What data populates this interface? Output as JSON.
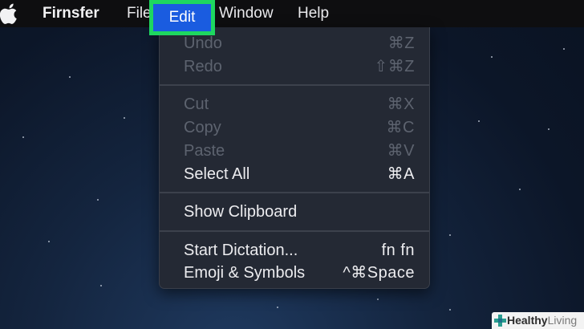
{
  "menubar": {
    "app_name": "Firnsfer",
    "items": [
      {
        "label": "File"
      },
      {
        "label": "Edit",
        "highlighted": true
      },
      {
        "label": "Window"
      },
      {
        "label": "Help"
      }
    ],
    "highlight_color": "#1ed760",
    "selected_color": "#1a5ce0"
  },
  "edit_menu": {
    "items": [
      {
        "label": "Undo",
        "shortcut": "⌘Z",
        "enabled": false
      },
      {
        "label": "Redo",
        "shortcut": "⇧⌘Z",
        "enabled": false
      },
      {
        "label": "Cut",
        "shortcut": "⌘X",
        "enabled": false
      },
      {
        "label": "Copy",
        "shortcut": "⌘C",
        "enabled": false
      },
      {
        "label": "Paste",
        "shortcut": "⌘V",
        "enabled": false
      },
      {
        "label": "Select All",
        "shortcut": "⌘A",
        "enabled": true
      },
      {
        "label": "Show Clipboard",
        "shortcut": "",
        "enabled": true
      },
      {
        "label": "Start Dictation...",
        "shortcut": "fn fn",
        "enabled": true
      },
      {
        "label": "Emoji & Symbols",
        "shortcut": "^⌘Space",
        "enabled": true
      }
    ]
  },
  "watermark": {
    "brand_bold": "Healthy",
    "brand_light": "Living"
  }
}
